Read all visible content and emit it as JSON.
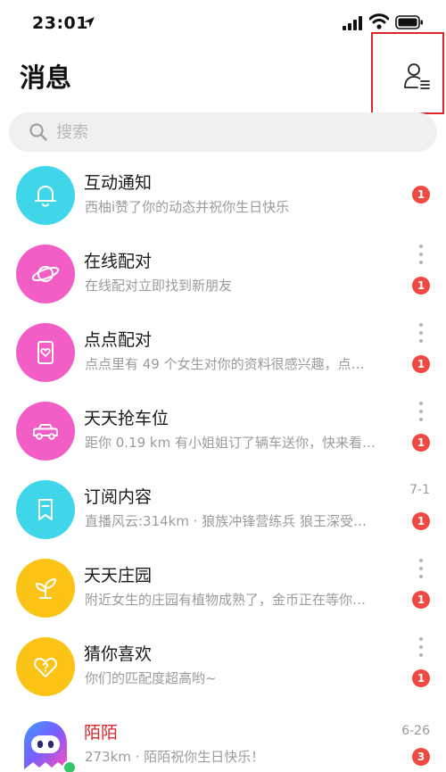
{
  "status_bar": {
    "time": "23:01"
  },
  "header": {
    "title": "消息"
  },
  "search": {
    "placeholder": "搜索"
  },
  "colors": {
    "highlight_box": "#d9262b",
    "badge": "#ef4a42",
    "cyan": "#3fd6ea",
    "pink": "#f35ec6",
    "yellow": "#fbc316"
  },
  "messages": [
    {
      "title": "互动通知",
      "subtitle": "西柚i赞了你的动态并祝你生日快乐",
      "badge": "1",
      "icon": "bell-icon"
    },
    {
      "title": "在线配对",
      "subtitle": "在线配对立即找到新朋友",
      "badge": "1",
      "icon": "planet-icon"
    },
    {
      "title": "点点配对",
      "subtitle": "点点里有 49 个女生对你的资料很感兴趣，点…",
      "badge": "1",
      "icon": "heart-card-icon"
    },
    {
      "title": "天天抢车位",
      "subtitle": "距你 0.19 km 有小姐姐订了辆车送你，快来看…",
      "badge": "1",
      "icon": "car-icon"
    },
    {
      "title": "订阅内容",
      "subtitle": "直播风云:314km · 狼族冲锋营练兵 狼王深受…",
      "badge": "1",
      "date": "7-1",
      "icon": "bookmark-icon"
    },
    {
      "title": "天天庄园",
      "subtitle": "附近女生的庄园有植物成熟了，金币正在等你…",
      "badge": "1",
      "icon": "sprout-icon"
    },
    {
      "title": "猜你喜欢",
      "subtitle": "你们的匹配度超高哟~",
      "badge": "1",
      "icon": "question-heart-icon"
    },
    {
      "title": "陌陌",
      "subtitle": "273km · 陌陌祝你生日快乐！",
      "badge": "3",
      "date": "6-26",
      "icon": "momo-logo-icon"
    }
  ]
}
